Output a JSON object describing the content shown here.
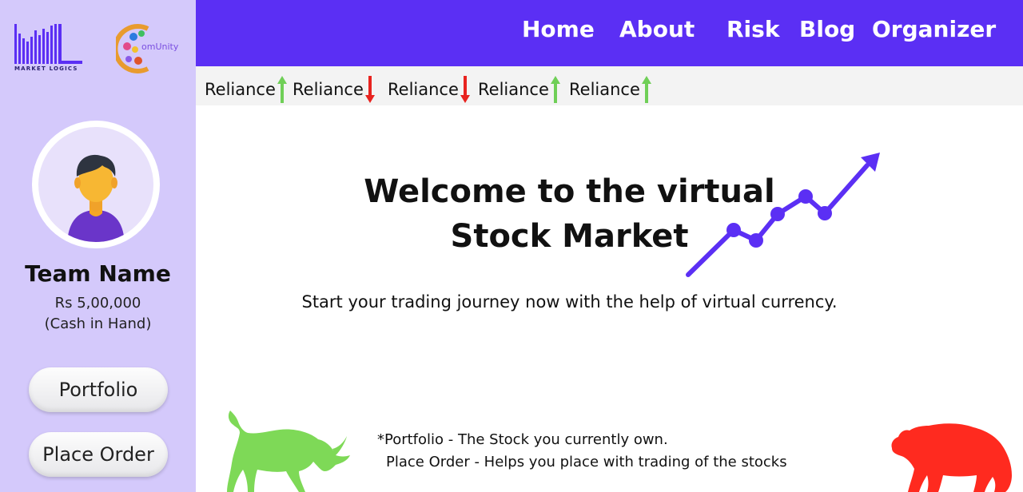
{
  "sidebar": {
    "logo_market_logics": "MARKET LOGICS",
    "logo_community": "omUnity",
    "team_name": "Team Name",
    "cash_amount": "Rs 5,00,000",
    "cash_label": "(Cash in Hand)",
    "buttons": {
      "portfolio": "Portfolio",
      "place_order": "Place Order"
    }
  },
  "nav": {
    "items": [
      {
        "label": "Home"
      },
      {
        "label": "About"
      },
      {
        "label": "Risk"
      },
      {
        "label": "Blog"
      },
      {
        "label": "Organizer"
      }
    ]
  },
  "ticker": {
    "items": [
      {
        "label": "Reliance",
        "direction": "up",
        "color": "#6fcf57"
      },
      {
        "label": "Reliance",
        "direction": "down",
        "color": "#e8231f"
      },
      {
        "label": "Reliance",
        "direction": "down",
        "color": "#e8231f"
      },
      {
        "label": "Reliance",
        "direction": "up",
        "color": "#6fcf57"
      },
      {
        "label": "Reliance",
        "direction": "up",
        "color": "#6fcf57"
      }
    ]
  },
  "main": {
    "welcome_line1": "Welcome to the virtual",
    "welcome_line2": "Stock Market",
    "subtitle": "Start your trading journey now with the help of virtual currency.",
    "note_portfolio": "*Portfolio - The Stock you currently own.",
    "note_place_order": "Place Order - Helps you place with trading of the stocks"
  },
  "colors": {
    "accent": "#5b2ff4",
    "sidebar_bg": "#d4c9fb",
    "up": "#6fcf57",
    "down": "#e8231f",
    "bull": "#7ed957",
    "bear": "#ff2a1f"
  },
  "icons": [
    "market-logics-logo",
    "community-logo",
    "user-avatar-icon",
    "arrow-up-icon",
    "arrow-down-icon",
    "trend-chart-icon",
    "bull-icon",
    "bear-icon"
  ]
}
